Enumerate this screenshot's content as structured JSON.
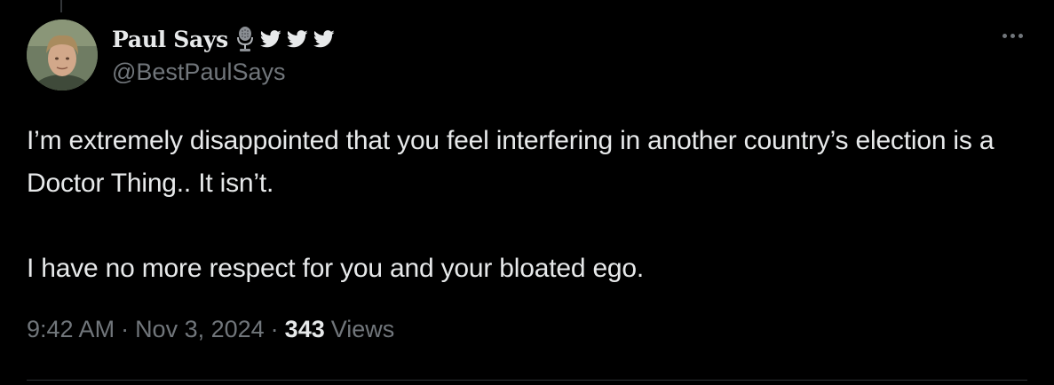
{
  "author": {
    "display_name": "Paul Says",
    "handle": "@BestPaulSays",
    "badges": [
      "microphone-icon",
      "twitter-bird-icon",
      "twitter-bird-icon",
      "twitter-bird-icon"
    ]
  },
  "tweet": {
    "paragraph_1": "I’m extremely disappointed that you feel interfering in another country’s election is a Doctor Thing.. It isn’t.",
    "paragraph_2": "I have no more respect for you and your bloated ego."
  },
  "meta": {
    "time": "9:42 AM",
    "separator": "·",
    "date": "Nov 3, 2024",
    "views_count": "343",
    "views_label": "Views"
  },
  "colors": {
    "background": "#000000",
    "text": "#e7e9ea",
    "secondary_text": "#71767b",
    "divider": "#2f3336"
  }
}
